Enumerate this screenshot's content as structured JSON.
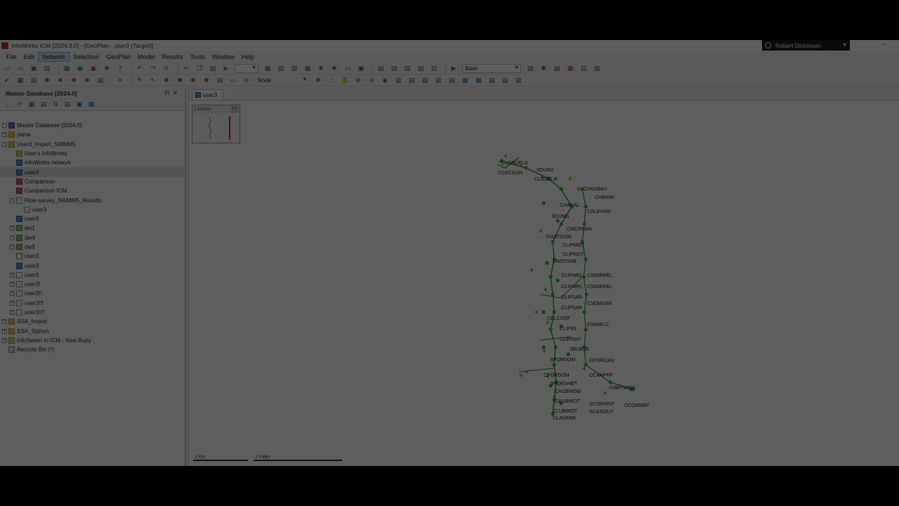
{
  "window": {
    "title": "InfoWorks ICM [2024.3.0] - [GeoPlan - user3 (Target)]"
  },
  "user": {
    "name": "Robert Dickinson"
  },
  "menu": [
    "File",
    "Edit",
    "Network",
    "Selection",
    "GeoPlan",
    "Model",
    "Results",
    "Tools",
    "Window",
    "Help"
  ],
  "toolbar": {
    "scenario": "Base",
    "object_type": "Node"
  },
  "panel": {
    "title": "Master Database [2024.0]",
    "tree": [
      {
        "label": "Master Database [2024.0]",
        "icon": "db",
        "level": 0,
        "exp": "minus"
      },
      {
        "label": "yama",
        "icon": "folder",
        "level": 0,
        "exp": "plus"
      },
      {
        "label": "User3_Import_SWMM5",
        "icon": "folder",
        "level": 0,
        "exp": "minus"
      },
      {
        "label": "User's InfoWorks",
        "icon": "folder",
        "level": 1,
        "exp": "none"
      },
      {
        "label": "InfoWorks network",
        "icon": "net",
        "level": 1,
        "exp": "none"
      },
      {
        "label": "user3",
        "icon": "net",
        "level": 1,
        "exp": "none",
        "selected": true
      },
      {
        "label": "Comparison",
        "icon": "cmp",
        "level": 1,
        "exp": "none"
      },
      {
        "label": "Comparison ICM",
        "icon": "cmp",
        "level": 1,
        "exp": "none"
      },
      {
        "label": "Flow survey_SWMM5_Results",
        "icon": "flow",
        "level": 1,
        "exp": "minus"
      },
      {
        "label": "user3",
        "icon": "flow",
        "level": 2,
        "exp": "none"
      },
      {
        "label": "user3",
        "icon": "net",
        "level": 1,
        "exp": "none"
      },
      {
        "label": "dw1",
        "icon": "run",
        "level": 1,
        "exp": "plus"
      },
      {
        "label": "dw4",
        "icon": "run",
        "level": 1,
        "exp": "plus"
      },
      {
        "label": "dw9",
        "icon": "run",
        "level": 1,
        "exp": "plus"
      },
      {
        "label": "user3",
        "icon": "graph",
        "level": 1,
        "exp": "none"
      },
      {
        "label": "user3",
        "icon": "net",
        "level": 1,
        "exp": "none"
      },
      {
        "label": "user3",
        "icon": "sim",
        "level": 1,
        "exp": "plus"
      },
      {
        "label": "user3!",
        "icon": "sim",
        "level": 1,
        "exp": "plus"
      },
      {
        "label": "user3!!",
        "icon": "sim",
        "level": 1,
        "exp": "plus"
      },
      {
        "label": "user3!!!",
        "icon": "sim",
        "level": 1,
        "exp": "plus"
      },
      {
        "label": "user3!!!!",
        "icon": "sim",
        "level": 1,
        "exp": "plus"
      },
      {
        "label": "SSA_Import",
        "icon": "folder",
        "level": 0,
        "exp": "plus"
      },
      {
        "label": "SSA_Siphon",
        "icon": "folder",
        "level": 0,
        "exp": "plus"
      },
      {
        "label": "InfoSewer to ICM - New Ruby",
        "icon": "folder",
        "level": 0,
        "exp": "plus"
      },
      {
        "label": "Recycle Bin (*)",
        "icon": "bin",
        "level": 0,
        "exp": "none"
      }
    ]
  },
  "document": {
    "tab": "user3",
    "locator_title": "Locator",
    "scale_labels": [
      "1 km",
      "1 miles"
    ]
  },
  "network_labels": [
    "CLOSCELA",
    "CCECKON",
    "SDUM2",
    "CLOSELB",
    "CHIGMAU",
    "CHEN90",
    "CHAKAL",
    "CALEXAN",
    "SDUMS",
    "CMCPRAN",
    "CHOTDOM",
    "CLIPMOT",
    "CLIPNOT",
    "SNOTSHB",
    "CLIPWEL",
    "CSDMWEL",
    "CLIPWEL",
    "CSDMWEL",
    "CLIPSAR",
    "CSDMSAR",
    "CLIPSAR",
    "CELCSRF",
    "CSIMELC",
    "CLIP35",
    "CLIPSM7",
    "SBUR28",
    "SPORDOM",
    "CPORCAN",
    "CPORDOM",
    "CCANPRF",
    "SPORSHB",
    "CMRYWSM",
    "CAOBWSM",
    "CAUBWOT",
    "SCORMNT",
    "CCORMNT",
    "CLUBWOT",
    "SCANOUT",
    "CLAUPAR"
  ],
  "colors": {
    "accent": "#cfe3f7",
    "node": "#22c322",
    "pipe": "#2e8b2e",
    "arrow": "#8a8a30",
    "locator_line": "#d62828"
  }
}
